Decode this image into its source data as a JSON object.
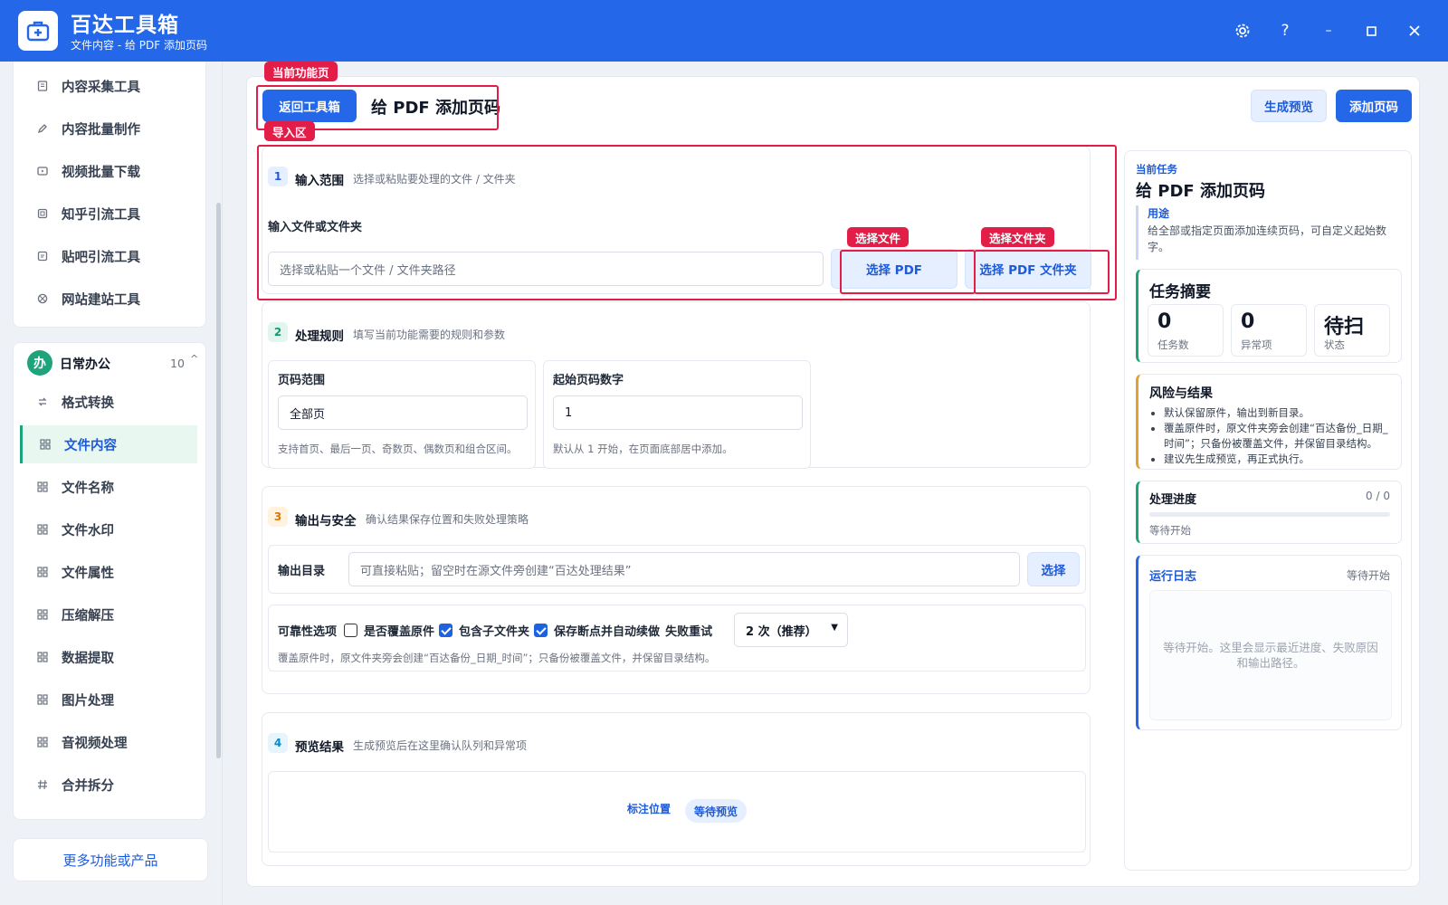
{
  "app": {
    "title": "百达工具箱",
    "subtitle": "文件内容 - 给 PDF 添加页码"
  },
  "window": {
    "icons": [
      "gear-icon",
      "help-icon",
      "minimize-icon",
      "maximize-icon",
      "close-icon"
    ],
    "help": "?"
  },
  "sidebar": {
    "top_items": [
      {
        "label": "内容采集工具",
        "icon": "doc-icon"
      },
      {
        "label": "内容批量制作",
        "icon": "pen-icon"
      },
      {
        "label": "视频批量下载",
        "icon": "video-icon"
      },
      {
        "label": "知乎引流工具",
        "icon": "zhihu-icon"
      },
      {
        "label": "贴吧引流工具",
        "icon": "tieba-icon"
      },
      {
        "label": "网站建站工具",
        "icon": "globe-icon"
      }
    ],
    "group": {
      "badge": "办",
      "title": "日常办公",
      "count": "10",
      "chevron": "^"
    },
    "group_items": [
      {
        "label": "格式转换",
        "icon": "swap-icon"
      },
      {
        "label": "文件内容",
        "icon": "grid-icon",
        "active": true
      },
      {
        "label": "文件名称",
        "icon": "grid-icon"
      },
      {
        "label": "文件水印",
        "icon": "grid-icon"
      },
      {
        "label": "文件属性",
        "icon": "grid-icon"
      },
      {
        "label": "压缩解压",
        "icon": "grid-icon"
      },
      {
        "label": "数据提取",
        "icon": "grid-icon"
      },
      {
        "label": "图片处理",
        "icon": "grid-icon"
      },
      {
        "label": "音视频处理",
        "icon": "grid-icon"
      },
      {
        "label": "合并拆分",
        "icon": "hash-icon"
      }
    ],
    "more": "更多功能或产品"
  },
  "header": {
    "back": "返回工具箱",
    "title": "给 PDF 添加页码",
    "preview": "生成预览",
    "run": "添加页码"
  },
  "annotations": {
    "current_page": "当前功能页",
    "import": "导入区",
    "select_file": "选择文件",
    "select_folder": "选择文件夹"
  },
  "section1": {
    "num": "1",
    "title": "输入范围",
    "desc": "选择或粘贴要处理的文件 / 文件夹",
    "label": "输入文件或文件夹",
    "placeholder": "选择或粘贴一个文件 / 文件夹路径",
    "pick_pdf": "选择 PDF",
    "pick_folder": "选择 PDF 文件夹"
  },
  "section2": {
    "num": "2",
    "title": "处理规则",
    "desc": "填写当前功能需要的规则和参数",
    "range_label": "页码范围",
    "range_value": "全部页",
    "range_hint": "支持首页、最后一页、奇数页、偶数页和组合区间。",
    "start_label": "起始页码数字",
    "start_value": "1",
    "start_hint": "默认从 1 开始，在页面底部居中添加。"
  },
  "section3": {
    "num": "3",
    "title": "输出与安全",
    "desc": "确认结果保存位置和失败处理策略",
    "out_label": "输出目录",
    "out_placeholder": "可直接粘贴；留空时在源文件旁创建“百达处理结果”",
    "out_pick": "选择",
    "opt_label": "可靠性选项",
    "opt_overwrite": "是否覆盖原件",
    "opt_sub": "包含子文件夹",
    "opt_resume": "保存断点并自动续做",
    "retry_label": "失败重试",
    "retry_value": "2 次（推荐）",
    "hint": "覆盖原件时，原文件夹旁会创建“百达备份_日期_时间”；只备份被覆盖文件，并保留目录结构。"
  },
  "section4": {
    "num": "4",
    "title": "预览结果",
    "desc": "生成预览后在这里确认队列和异常项",
    "mark": "标注位置",
    "badge": "等待预览"
  },
  "right": {
    "task_label": "当前任务",
    "task_title": "给 PDF 添加页码",
    "use_label": "用途",
    "use_text": "给全部或指定页面添加连续页码，可自定义起始数字。",
    "summary": {
      "title": "任务摘要",
      "stats": [
        {
          "v": "0",
          "k": "任务数"
        },
        {
          "v": "0",
          "k": "异常项"
        },
        {
          "v": "待扫",
          "k": "状态"
        }
      ]
    },
    "risk": {
      "title": "风险与结果",
      "items": [
        "默认保留原件，输出到新目录。",
        "覆盖原件时，原文件夹旁会创建“百达备份_日期_时间”；只备份被覆盖文件，并保留目录结构。",
        "建议先生成预览，再正式执行。"
      ]
    },
    "progress": {
      "title": "处理进度",
      "value": "0 / 0",
      "status": "等待开始",
      "fraction": 0
    },
    "log": {
      "title": "运行日志",
      "status": "等待开始",
      "placeholder": "等待开始。这里会显示最近进度、失败原因和输出路径。"
    }
  }
}
